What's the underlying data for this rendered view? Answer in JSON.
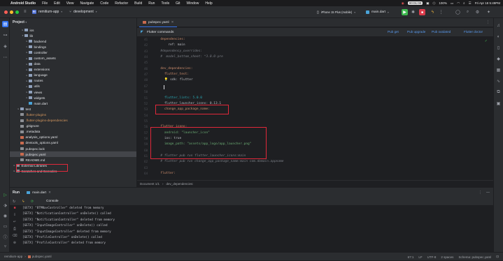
{
  "macos": {
    "app_name": "Android Studio",
    "menus": [
      "File",
      "Edit",
      "View",
      "Navigate",
      "Code",
      "Refactor",
      "Build",
      "Run",
      "Tools",
      "Git",
      "Window",
      "Help"
    ],
    "time_indicator": "00:01:00",
    "battery": "100%",
    "datetime": "Fri Apr 18  5:49PM"
  },
  "titlebar": {
    "project_badge": "RI",
    "project": "remitium-app",
    "branch": "development",
    "device": "iPhone 15 Plus (mobile)",
    "run_config": "main.dart"
  },
  "project_panel": {
    "title": "Project",
    "tree": [
      {
        "depth": 1,
        "label": "ios",
        "icon": "folder-icon",
        "expanded": false,
        "style": "normal"
      },
      {
        "depth": 1,
        "label": "lib",
        "icon": "folder-icon",
        "expanded": true,
        "style": "normal"
      },
      {
        "depth": 2,
        "label": "backend",
        "icon": "folder-icon",
        "expanded": false,
        "style": "normal"
      },
      {
        "depth": 2,
        "label": "bindings",
        "icon": "folder-icon",
        "expanded": false,
        "style": "normal"
      },
      {
        "depth": 2,
        "label": "controller",
        "icon": "folder-icon",
        "expanded": false,
        "style": "normal"
      },
      {
        "depth": 2,
        "label": "custom_assets",
        "icon": "folder-icon",
        "expanded": false,
        "style": "normal"
      },
      {
        "depth": 2,
        "label": "data",
        "icon": "folder-icon",
        "expanded": false,
        "style": "normal"
      },
      {
        "depth": 2,
        "label": "extensions",
        "icon": "folder-icon",
        "expanded": false,
        "style": "normal"
      },
      {
        "depth": 2,
        "label": "language",
        "icon": "folder-icon",
        "expanded": false,
        "style": "normal"
      },
      {
        "depth": 2,
        "label": "routes",
        "icon": "folder-icon",
        "expanded": false,
        "style": "normal"
      },
      {
        "depth": 2,
        "label": "utils",
        "icon": "folder-icon",
        "expanded": false,
        "style": "normal"
      },
      {
        "depth": 2,
        "label": "views",
        "icon": "folder-icon",
        "expanded": false,
        "style": "normal"
      },
      {
        "depth": 2,
        "label": "widgets",
        "icon": "folder-icon",
        "expanded": false,
        "style": "normal"
      },
      {
        "depth": 2,
        "label": "main.dart",
        "icon": "dart-file-icon",
        "expanded": null,
        "style": "normal"
      },
      {
        "depth": 0,
        "label": "test",
        "icon": "folder-icon",
        "expanded": false,
        "style": "normal"
      },
      {
        "depth": 0,
        "label": ".flutter-plugins",
        "icon": "file-icon",
        "expanded": null,
        "style": "orange"
      },
      {
        "depth": 0,
        "label": ".flutter-plugins-dependencies",
        "icon": "file-icon",
        "expanded": null,
        "style": "orange"
      },
      {
        "depth": 0,
        "label": ".gitignore",
        "icon": "file-icon",
        "expanded": null,
        "style": "normal"
      },
      {
        "depth": 0,
        "label": ".metadata",
        "icon": "file-icon",
        "expanded": null,
        "style": "normal"
      },
      {
        "depth": 0,
        "label": "analysis_options.yaml",
        "icon": "yaml-file-icon",
        "expanded": null,
        "style": "normal"
      },
      {
        "depth": 0,
        "label": "devtools_options.yaml",
        "icon": "yaml-file-icon",
        "expanded": null,
        "style": "normal"
      },
      {
        "depth": 0,
        "label": "pubspec.lock",
        "icon": "file-icon",
        "expanded": null,
        "style": "normal"
      },
      {
        "depth": 0,
        "label": "pubspec.yaml",
        "icon": "yaml-file-icon",
        "expanded": null,
        "style": "selected"
      },
      {
        "depth": 0,
        "label": "README.md",
        "icon": "file-icon",
        "expanded": null,
        "style": "normal"
      },
      {
        "depth": -1,
        "label": "External Libraries",
        "icon": "library-icon",
        "expanded": false,
        "style": "normal"
      },
      {
        "depth": -1,
        "label": "Scratches and Consoles",
        "icon": "scratch-icon",
        "expanded": false,
        "style": "normal"
      }
    ]
  },
  "editor": {
    "tab": "pubspec.yaml",
    "flutter_commands": {
      "label": "Flutter commands",
      "actions": [
        "Pub get",
        "Pub upgrade",
        "Pub outdated",
        "Flutter doctor"
      ]
    },
    "lines": [
      {
        "no": "41",
        "text": "  dependencies:",
        "cls": "k"
      },
      {
        "no": "42",
        "text": "      ref: main",
        "cls": "w"
      },
      {
        "no": "43",
        "text": "  #dependency_overrides:",
        "cls": "c"
      },
      {
        "no": "44",
        "text": "  #  model_bottom_sheet: ^3.0.0-pre",
        "cls": "c"
      },
      {
        "no": "45",
        "text": "",
        "cls": "w"
      },
      {
        "no": "46",
        "text": "  dev_dependencies:",
        "cls": "k"
      },
      {
        "no": "47",
        "text": "    flutter_test:",
        "cls": "k"
      },
      {
        "no": "48",
        "text": "    💡 sdk: flutter",
        "cls": "w"
      },
      {
        "no": "67",
        "text": "",
        "cls": "w"
      },
      {
        "no": "50",
        "text": "",
        "cls": "w"
      },
      {
        "no": "51",
        "text": "    flutter_lints: 5.0.0",
        "cls": "n"
      },
      {
        "no": "52",
        "text": "    flutter_launcher_icons: 0.13.1",
        "cls": "w"
      },
      {
        "no": "53",
        "text": "    change_app_package_name:",
        "cls": "k"
      },
      {
        "no": "54",
        "text": "",
        "cls": "w"
      },
      {
        "no": "55",
        "text": "",
        "cls": "w"
      },
      {
        "no": "56",
        "text": "  flutter_icons:",
        "cls": "k"
      },
      {
        "no": "57",
        "text": "    android: \"launcher_icon\"",
        "cls": "s"
      },
      {
        "no": "58",
        "text": "    ios: true",
        "cls": "w"
      },
      {
        "no": "59",
        "text": "    image_path: \"assets/app_logo/app_launcher.png\"",
        "cls": "s"
      },
      {
        "no": "60",
        "text": "",
        "cls": "w"
      },
      {
        "no": "61",
        "text": "  # flutter pub run flutter_launcher_icons:main",
        "cls": "c"
      },
      {
        "no": "62",
        "text": "  # flutter pub run change_app_package_name:main com.domain.appname",
        "cls": "c"
      },
      {
        "no": "63",
        "text": "",
        "cls": "w"
      },
      {
        "no": "64",
        "text": "  flutter:",
        "cls": "k"
      }
    ],
    "breadcrumb": [
      "Document 1/1",
      "dev_dependencies:"
    ]
  },
  "run_panel": {
    "title": "Run",
    "tab": "main.dart",
    "console_label": "Console",
    "logs": [
      "[GETX] \"BTMNavController\" deleted from memory",
      "[GETX] \"NotificationController\" onDelete() called",
      "[GETX] \"NotificationController\" deleted from memory",
      "[GETX] \"InputImageController\" onDelete() called",
      "[GETX] \"InputImageController\" deleted from memory",
      "[GETX] \"ProfileController\" onDelete() called",
      "[GETX] \"ProfileController\" deleted from memory"
    ]
  },
  "statusbar": {
    "path": [
      "remitium-app",
      "pubspec.yaml"
    ],
    "position": "67:1",
    "line_sep": "LF",
    "encoding": "UTF-8",
    "indent": "2 spaces",
    "schema": "Schema: pubspec.yaml"
  },
  "colors": {
    "accent": "#3574f0",
    "highlight": "#e0283a",
    "run_green": "#3fb950",
    "stop_red": "#db3b4b"
  }
}
